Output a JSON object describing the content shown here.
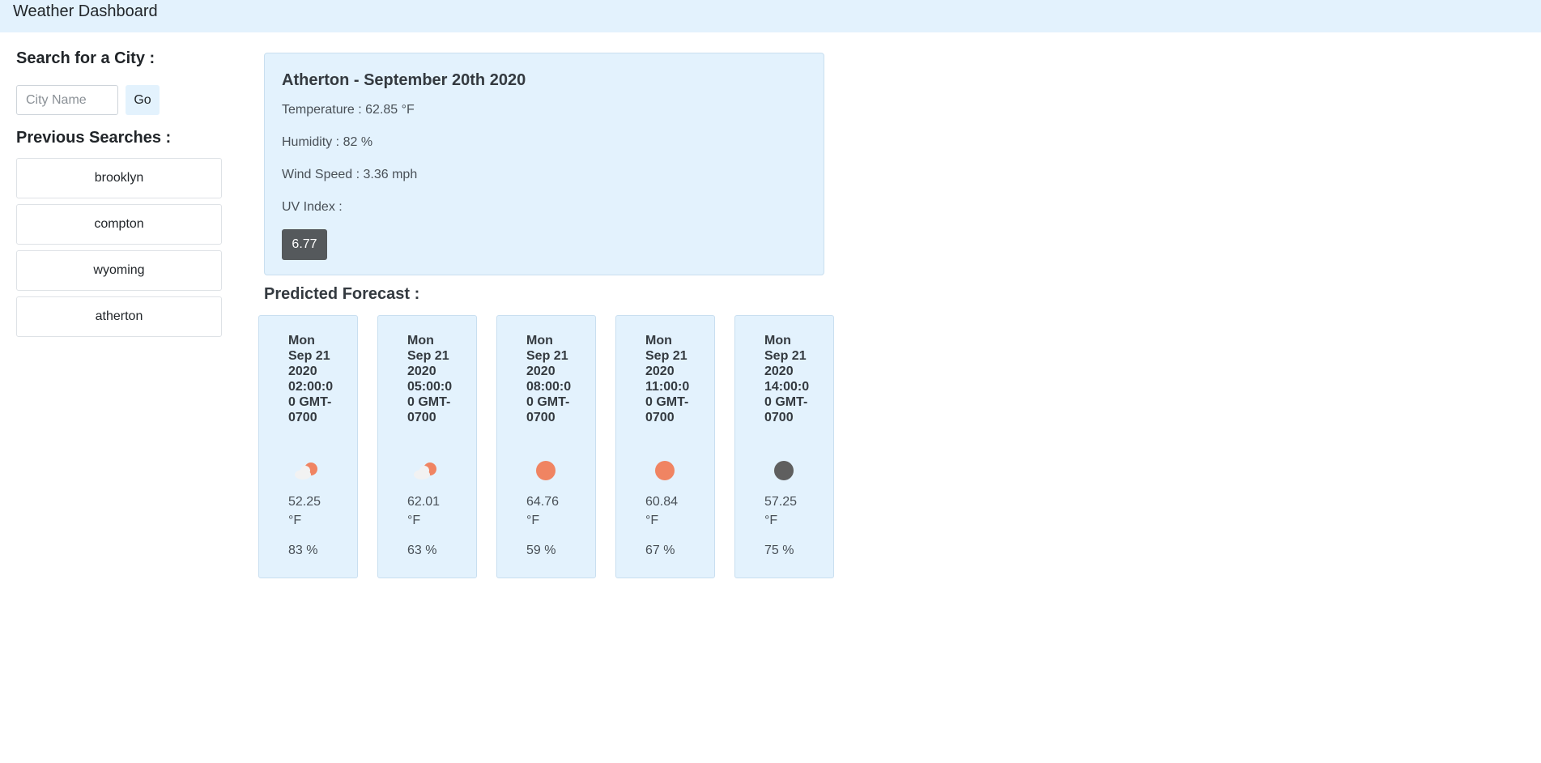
{
  "navbar": {
    "brand": "Weather Dashboard"
  },
  "search": {
    "heading": "Search for a City :",
    "placeholder": "City Name",
    "button_label": "Go"
  },
  "history": {
    "heading": "Previous Searches :",
    "items": [
      "brooklyn",
      "compton",
      "wyoming",
      "atherton"
    ]
  },
  "current": {
    "title": "Atherton - September 20th 2020",
    "temperature": "Temperature : 62.85 °F",
    "humidity": "Humidity : 82 %",
    "wind": "Wind Speed : 3.36 mph",
    "uv_label": "UV Index :",
    "uv_value": "6.77",
    "uv_color": "#55595c"
  },
  "forecast": {
    "heading": "Predicted Forecast :",
    "cards": [
      {
        "date": "Mon Sep 21 2020 02:00:00 GMT-0700",
        "icon": "partly-cloudy-icon",
        "temp": "52.25 °F",
        "humidity": "83 %"
      },
      {
        "date": "Mon Sep 21 2020 05:00:00 GMT-0700",
        "icon": "partly-cloudy-icon",
        "temp": "62.01 °F",
        "humidity": "63 %"
      },
      {
        "date": "Mon Sep 21 2020 08:00:00 GMT-0700",
        "icon": "sun-icon",
        "temp": "64.76 °F",
        "humidity": "59 %"
      },
      {
        "date": "Mon Sep 21 2020 11:00:00 GMT-0700",
        "icon": "sun-icon",
        "temp": "60.84 °F",
        "humidity": "67 %"
      },
      {
        "date": "Mon Sep 21 2020 14:00:00 GMT-0700",
        "icon": "dark-circle-icon",
        "temp": "57.25 °F",
        "humidity": "75 %"
      }
    ]
  },
  "colors": {
    "panel_bg": "#e3f2fd",
    "sun": "#f08462",
    "dark": "#5f5f5f",
    "cloud": "#f2f2f2"
  }
}
